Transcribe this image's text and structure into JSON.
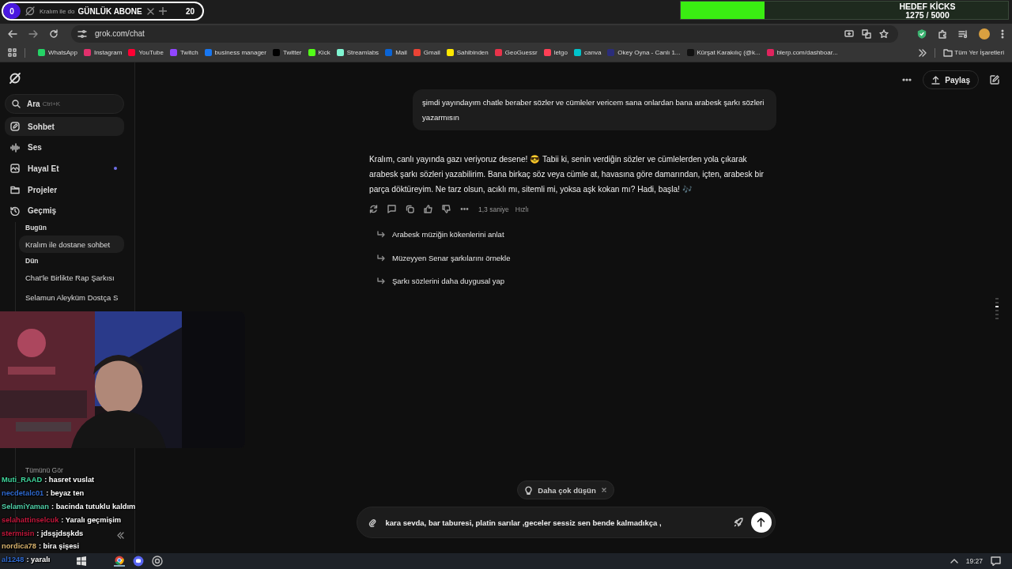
{
  "stream_overlay": {
    "sub_counter": {
      "current": "0",
      "label": "GÜNLÜK ABONE",
      "goal": "20"
    },
    "goal_bar": {
      "title": "HEDEF KİCKS",
      "reading": "1275 / 5000",
      "level": 0.255
    }
  },
  "browser": {
    "tab": {
      "title": "Kralım ile do"
    },
    "address": "grok.com/chat",
    "bookmarks": [
      {
        "label": "WhatsApp",
        "color": "#25d366"
      },
      {
        "label": "Instagram",
        "color": "#e1306c"
      },
      {
        "label": "YouTube",
        "color": "#ff0033"
      },
      {
        "label": "Twitch",
        "color": "#9146ff"
      },
      {
        "label": "business manager",
        "color": "#1877f2"
      },
      {
        "label": "Twitter",
        "color": "#000000"
      },
      {
        "label": "Kick",
        "color": "#53fc18"
      },
      {
        "label": "Streamlabs",
        "color": "#80f5d2"
      },
      {
        "label": "Mail",
        "color": "#0a64d6"
      },
      {
        "label": "Gmail",
        "color": "#ea4335"
      },
      {
        "label": "Sahibinden",
        "color": "#ffe800"
      },
      {
        "label": "GeoGuessr",
        "color": "#e8334a"
      },
      {
        "label": "letgo",
        "color": "#ff3f55"
      },
      {
        "label": "canva",
        "color": "#00c4cc"
      },
      {
        "label": "Okey Oyna - Canlı 1...",
        "color": "#2b2d7a"
      },
      {
        "label": "Kürşat Karakılıç (@k...",
        "color": "#111111"
      },
      {
        "label": "blerp.com/dashboar...",
        "color": "#e0245e"
      }
    ],
    "all_bookmarks": "Tüm Yer İşaretleri"
  },
  "sidebar": {
    "search": {
      "placeholder": "Ara",
      "shortcut": "Ctrl+K"
    },
    "nav": [
      {
        "kind": "chat",
        "label": "Sohbet",
        "selected": true,
        "dot": false
      },
      {
        "kind": "voice",
        "label": "Ses",
        "selected": false,
        "dot": false
      },
      {
        "kind": "imagine",
        "label": "Hayal Et",
        "selected": false,
        "dot": true
      },
      {
        "kind": "projects",
        "label": "Projeler",
        "selected": false,
        "dot": false
      },
      {
        "kind": "history",
        "label": "Geçmiş",
        "selected": false,
        "dot": false
      }
    ],
    "history": [
      {
        "label": "Bugün",
        "items": [
          {
            "title": "Kralım ile dostane sohbet",
            "selected": true
          }
        ]
      },
      {
        "label": "Dün",
        "items": [
          {
            "title": "Chat'le Birlikte Rap Şarkısı",
            "selected": false
          },
          {
            "title": "Selamun Aleyküm Dostça S",
            "selected": false
          }
        ]
      }
    ],
    "see_all": "Tümünü Gör"
  },
  "header": {
    "share": "Paylaş"
  },
  "conversation": {
    "user_message": "şimdi yayındayım chatle beraber sözler ve cümleler vericem sana onlardan bana arabesk şarkı sözleri yazarmısın",
    "reply": "Kralım, canlı yayında gazı veriyoruz desene! 😎 Tabii ki, senin verdiğin sözler ve cümlelerden yola çıkarak arabesk şarkı sözleri yazabilirim. Bana birkaç söz veya cümle at, havasına göre damarından, içten, arabesk bir parça döktüreyim. Ne tarz olsun, acıklı mı, sitemli mi, yoksa aşk kokan mı? Hadi, başla! 🎶",
    "meta": {
      "time": "1,3 saniye",
      "mode": "Hızlı"
    },
    "suggestions": [
      "Arabesk müziğin kökenlerini anlat",
      "Müzeyyen Senar şarkılarını örnekle",
      "Şarkı sözlerini daha duygusal yap"
    ]
  },
  "composer": {
    "think_chip": "Daha çok düşün",
    "value": "kara sevda, bar taburesi, platin sarılar ,geceler sessiz sen bende kalmadıkça ,"
  },
  "stream_chat": [
    {
      "user": "Muti_RAAD",
      "color": "#3fd69c",
      "text": ": hasret vuslat"
    },
    {
      "user": "necdetalc01",
      "color": "#2f6ad0",
      "text": ": beyaz ten"
    },
    {
      "user": "SelamiYaman",
      "color": "#4fd0a8",
      "text": ": bacinda tutuklu kaldım"
    },
    {
      "user": "selahattinselcuk",
      "color": "#c4183c",
      "text": ": Yaralı geçmişim"
    },
    {
      "user": "stermisin",
      "color": "#c4183c",
      "text": ": jdsşjdsşkds"
    },
    {
      "user": "nordica78",
      "color": "#d9b46e",
      "text": ": bira şişesi"
    },
    {
      "user": "al1248",
      "color": "#2f6ad0",
      "text": ": yaralı"
    }
  ],
  "taskbar": {
    "clock": "19:27"
  }
}
